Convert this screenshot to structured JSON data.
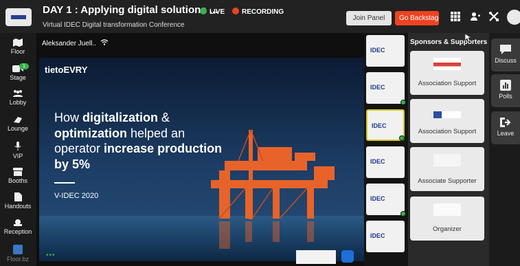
{
  "header": {
    "title": "DAY 1 : Applying digital solutions ...",
    "subtitle": "Virtual IDEC Digital transformation Conference",
    "live_label": "LIVE",
    "recording_label": "RECORDING",
    "join_panel_label": "Join Panel",
    "go_backstage_label": "Go Backstage",
    "colors": {
      "live": "#37b24d",
      "recording": "#ee4322",
      "backstage": "#ee4322"
    }
  },
  "left_nav": {
    "items": [
      {
        "label": "Floor",
        "icon": "map-icon"
      },
      {
        "label": "Stage",
        "icon": "video-icon",
        "badge": "1"
      },
      {
        "label": "Lobby",
        "icon": "people-icon"
      },
      {
        "label": "Lounge",
        "icon": "lounge-icon"
      },
      {
        "label": "VIP",
        "icon": "mic-icon"
      },
      {
        "label": "Booths",
        "icon": "booth-icon"
      },
      {
        "label": "Handouts",
        "icon": "document-icon"
      },
      {
        "label": "Reception",
        "icon": "reception-icon"
      },
      {
        "label": "Floor.bz",
        "icon": "floorbz-logo-icon"
      }
    ]
  },
  "video": {
    "speaker_name": "Aleksander Juell..",
    "slide": {
      "brand": "tietoEVRY",
      "headline_parts": [
        {
          "text": "How ",
          "bold": false
        },
        {
          "text": "digitalization",
          "bold": true
        },
        {
          "text": " & ",
          "bold": false
        },
        {
          "text": "optimization",
          "bold": true
        },
        {
          "text": " helped an operator ",
          "bold": false
        },
        {
          "text": "increase production",
          "bold": true
        },
        {
          "text": " by 5%",
          "bold": true
        }
      ],
      "event": "V-IDEC 2020"
    },
    "dots": "•••"
  },
  "thumbnails": [
    {
      "label": "IDEC",
      "selected": false,
      "online": false
    },
    {
      "label": "IDEC",
      "selected": false,
      "online": true
    },
    {
      "label": "IDEC",
      "selected": true,
      "online": true
    },
    {
      "label": "IDEC",
      "selected": false,
      "online": false
    },
    {
      "label": "IDEC",
      "selected": false,
      "online": true
    },
    {
      "label": "IDEC",
      "selected": false,
      "online": false
    }
  ],
  "sponsors": {
    "title": "Sponsors & Supporters",
    "cards": [
      {
        "label": "Association Support",
        "logo": "innovation-logo"
      },
      {
        "label": "Association Support",
        "logo": "scottish-logo"
      },
      {
        "label": "Associate Supporter",
        "logo": "sodexo-logo"
      },
      {
        "label": "Organizer",
        "logo": "organizer-logo"
      }
    ]
  },
  "right_nav": {
    "items": [
      {
        "label": "Discuss",
        "icon": "chat-icon"
      },
      {
        "label": "Polls",
        "icon": "polls-icon"
      },
      {
        "label": "Leave",
        "icon": "leave-icon"
      }
    ]
  }
}
